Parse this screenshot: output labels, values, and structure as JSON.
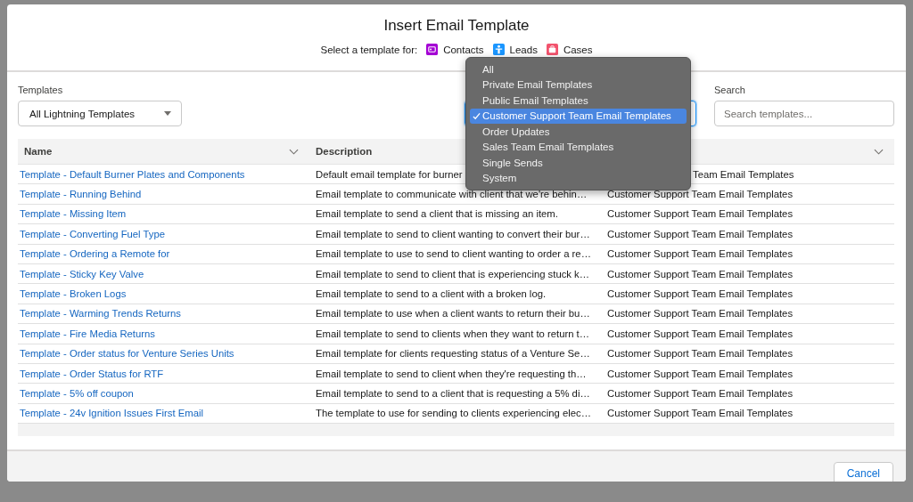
{
  "modal": {
    "title": "Insert Email Template",
    "subtitle": "Select a template for:",
    "object_types": [
      {
        "label": "Contacts",
        "kind": "contact",
        "color": "#a400d4"
      },
      {
        "label": "Leads",
        "kind": "lead",
        "color": "#1b96ff"
      },
      {
        "label": "Cases",
        "kind": "case",
        "color": "#f2536d"
      }
    ]
  },
  "templates_filter": {
    "label": "Templates",
    "value": "All Lightning Templates"
  },
  "folder_menu": {
    "items": [
      {
        "label": "All",
        "selected": false
      },
      {
        "label": "Private Email Templates",
        "selected": false
      },
      {
        "label": "Public Email Templates",
        "selected": false
      },
      {
        "label": "Customer Support Team Email Templates",
        "selected": true
      },
      {
        "label": "Order Updates",
        "selected": false
      },
      {
        "label": "Sales Team Email Templates",
        "selected": false
      },
      {
        "label": "Single Sends",
        "selected": false
      },
      {
        "label": "System",
        "selected": false
      }
    ]
  },
  "search": {
    "label": "Search",
    "placeholder": "Search templates..."
  },
  "table": {
    "columns": [
      "Name",
      "Description"
    ],
    "rows": [
      {
        "name": "Template - Default Burner Plates and Components",
        "description": "Default email template for burner",
        "column_3": "Team Email Templates"
      },
      {
        "name": "Template - Running Behind",
        "description": "Email template to communicate with client that we're behin…",
        "column_3": "Customer Support Team Email Templates"
      },
      {
        "name": "Template - Missing Item",
        "description": "Email template to send a client that is missing an item.",
        "column_3": "Customer Support Team Email Templates"
      },
      {
        "name": "Template - Converting Fuel Type",
        "description": "Email template to send to client wanting to convert their bur…",
        "column_3": "Customer Support Team Email Templates"
      },
      {
        "name": "Template - Ordering a Remote for",
        "description": "Email template to use to send to client wanting to order a re…",
        "column_3": "Customer Support Team Email Templates"
      },
      {
        "name": "Template - Sticky Key Valve",
        "description": "Email template to send to client that is experiencing stuck k…",
        "column_3": "Customer Support Team Email Templates"
      },
      {
        "name": "Template - Broken Logs",
        "description": "Email template to send to a client with a broken log.",
        "column_3": "Customer Support Team Email Templates"
      },
      {
        "name": "Template - Warming Trends Returns",
        "description": "Email template to use when a client wants to return their bu…",
        "column_3": "Customer Support Team Email Templates"
      },
      {
        "name": "Template - Fire Media Returns",
        "description": "Email template to send to clients when they want to return t…",
        "column_3": "Customer Support Team Email Templates"
      },
      {
        "name": "Template - Order status for Venture Series Units",
        "description": "Email template for clients requesting status of a Venture Se…",
        "column_3": "Customer Support Team Email Templates"
      },
      {
        "name": "Template - Order Status for RTF",
        "description": "Email template to send to client when they're requesting th…",
        "column_3": "Customer Support Team Email Templates"
      },
      {
        "name": "Template - 5% off coupon",
        "description": "Email template to send to a client that is requesting a 5% di…",
        "column_3": "Customer Support Team Email Templates"
      },
      {
        "name": "Template - 24v Ignition Issues First Email",
        "description": "The template to use for sending to clients experiencing elec…",
        "column_3": "Customer Support Team Email Templates"
      }
    ]
  },
  "footer": {
    "cancel": "Cancel"
  }
}
